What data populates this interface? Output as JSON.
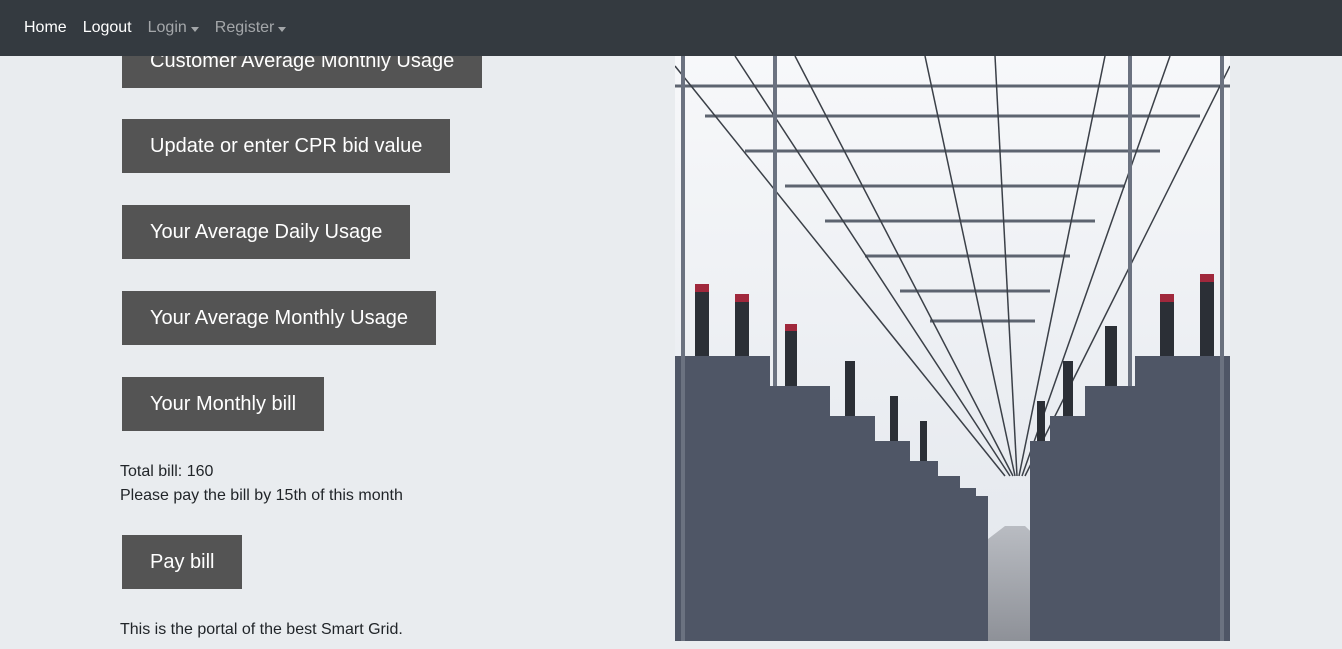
{
  "navbar": {
    "home": "Home",
    "logout": "Logout",
    "login": "Login",
    "register": "Register"
  },
  "buttons": {
    "customer_avg_monthly": "Customer Average Monthly Usage",
    "cpr_bid": "Update or enter CPR bid value",
    "avg_daily": "Your Average Daily Usage",
    "avg_monthly": "Your Average Monthly Usage",
    "monthly_bill": "Your Monthly bill",
    "pay_bill": "Pay bill"
  },
  "bill": {
    "total": "Total bill: 160",
    "due_notice": "Please pay the bill by 15th of this month"
  },
  "footer_text": "This is the portal of the best Smart Grid.",
  "colors": {
    "navbar_bg": "#343a40",
    "page_bg": "#e9ecef",
    "button_bg": "#545454"
  }
}
